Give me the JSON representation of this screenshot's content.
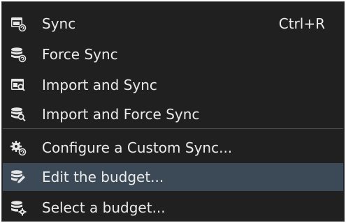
{
  "menu": {
    "items": [
      {
        "label": "Sync",
        "shortcut": "Ctrl+R",
        "icon": "sync-window-icon"
      },
      {
        "label": "Force Sync",
        "icon": "force-sync-database-icon"
      },
      {
        "label": "Import and Sync",
        "icon": "import-sync-window-icon"
      },
      {
        "label": "Import and Force Sync",
        "icon": "import-force-sync-database-icon"
      },
      {
        "label": "Configure a Custom Sync...",
        "icon": "configure-gears-icon"
      },
      {
        "label": "Edit the budget...",
        "icon": "edit-budget-icon",
        "highlighted": true
      },
      {
        "label": "Select a budget...",
        "icon": "select-budget-icon"
      }
    ]
  },
  "colors": {
    "menu_background": "#202020",
    "highlight": "#3c4a58",
    "text": "#ececec"
  }
}
